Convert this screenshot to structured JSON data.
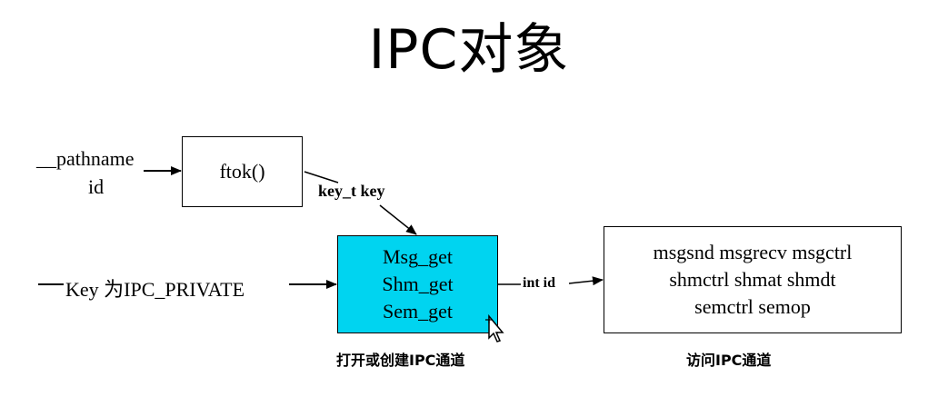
{
  "title": "IPC对象",
  "inputs": {
    "pathname": "__pathname",
    "id": "id",
    "key_private": "Key 为IPC_PRIVATE"
  },
  "ftok_box": {
    "label": "ftok()"
  },
  "key_label": "key_t key",
  "get_box": {
    "lines": [
      "Msg_get",
      "Shm_get",
      "Sem_get"
    ],
    "color": "#00d4f0"
  },
  "int_id_label": "int id",
  "access_box": {
    "lines": [
      "msgsnd msgrecv msgctrl",
      "shmctrl shmat shmdt",
      "semctrl semop"
    ]
  },
  "captions": {
    "open_create": "打开或创建IPC通道",
    "access": "访问IPC通道"
  }
}
